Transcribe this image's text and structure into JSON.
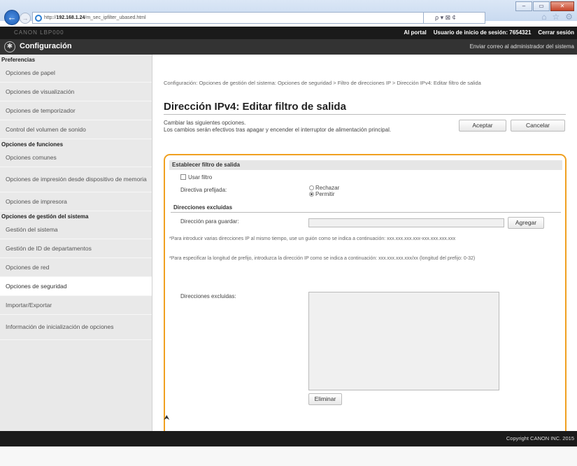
{
  "browser": {
    "url_prefix": "http://",
    "url_host": "192.168.1.24",
    "url_path": "/m_sec_ipfilter_ubased.html",
    "search_tools": "ρ ▾ ⊠ ¢",
    "window_controls": [
      "–",
      "▭",
      "✕"
    ]
  },
  "topbar": {
    "host": "CANON LBP000",
    "portal": "Al portal",
    "user_label": "Usuario de inicio de sesión:",
    "user_value": "7654321",
    "logout": "Cerrar sesión"
  },
  "header": {
    "title": "Configuración",
    "mail_admin": "Enviar correo al administrador del sistema"
  },
  "sidebar": {
    "groups": [
      {
        "heading": "Preferencias",
        "items": [
          {
            "label": "Opciones de papel"
          },
          {
            "label": "Opciones de visualización"
          },
          {
            "label": "Opciones de temporizador"
          },
          {
            "label": "Control del volumen de sonido"
          }
        ]
      },
      {
        "heading": "Opciones de funciones",
        "items": [
          {
            "label": "Opciones comunes"
          },
          {
            "label": "Opciones de impresión desde dispositivo de memoria"
          },
          {
            "label": "Opciones de impresora"
          }
        ]
      },
      {
        "heading": "Opciones de gestión del sistema",
        "items": [
          {
            "label": "Gestión del sistema"
          },
          {
            "label": "Gestión de ID de departamentos"
          },
          {
            "label": "Opciones de red"
          },
          {
            "label": "Opciones de seguridad"
          },
          {
            "label": "Importar/Exportar"
          },
          {
            "label": "Información de inicialización de opciones"
          }
        ]
      }
    ]
  },
  "main": {
    "breadcrumb": "Configuración: Opciones de gestión del sistema: Opciones de seguridad > Filtro de direcciones IP > Dirección IPv4: Editar filtro de salida",
    "title": "Dirección IPv4: Editar filtro de salida",
    "description": "Cambiar las siguientes opciones.\nLos cambios serán efectivos tras apagar y encender el interruptor de alimentación principal.",
    "ok_button": "Aceptar",
    "cancel_button": "Cancelar",
    "panel": {
      "heading": "Establecer filtro de salida",
      "use_filter_label": "Usar filtro",
      "use_filter_checked": false,
      "default_policy_label": "Directiva prefijada:",
      "policy_options": [
        "Rechazar",
        "Permitir"
      ],
      "policy_selected": "Permitir",
      "excluded_heading": "Direcciones excluidas",
      "address_to_save_label": "Dirección para guardar:",
      "address_to_save_value": "",
      "add_button": "Agregar",
      "note1": "*Para introducir varias direcciones IP al mismo tiempo, use un guión como se indica a continuación: xxx.xxx.xxx.xxx-xxx.xxx.xxx.xxx",
      "note2": "*Para especificar la longitud de prefijo, introduzca la dirección IP como se indica a continuación: xxx.xxx.xxx.xxx/xx (longitud del prefijo: 0-32)",
      "excluded_list_label": "Direcciones excluidas:",
      "delete_button": "Eliminar"
    },
    "to_top": "⮝"
  },
  "footer": {
    "copyright": "Copyright CANON INC. 2015"
  },
  "colors": {
    "panel_border": "#f0a020",
    "dark_bar": "#1a1a1a",
    "header": "#333333",
    "sidebar_bg": "#e9e9e9"
  }
}
